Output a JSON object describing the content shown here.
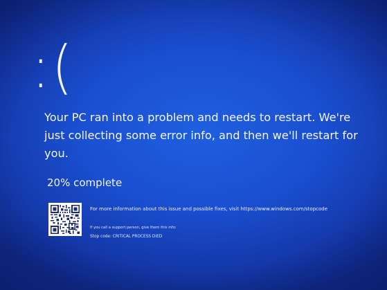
{
  "screen": {
    "background_color": "#1a4fd0",
    "text_color": "#ffffff"
  },
  "sad_face": ":(",
  "message": "Your PC ran into a problem and needs to restart. We're just collecting some error info, and then we'll restart for you.",
  "progress": {
    "text": "20% complete",
    "percent": 20
  },
  "qr_code": {
    "icon": "qr-code-icon"
  },
  "more_info": "For more information about this issue and possible fixes, visit https://www.windows.com/stopcode",
  "support_note": "If you call a support person, give them this info:",
  "stop_code": "Stop code: CRITICAL PROCESS DIED"
}
